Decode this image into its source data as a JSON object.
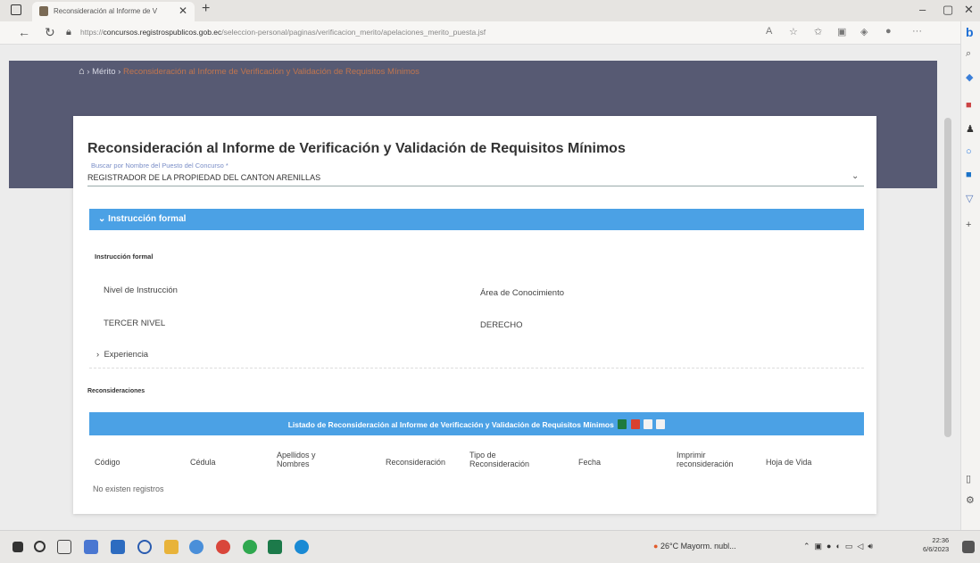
{
  "browser": {
    "tab_title": "Reconsideración al Informe de V",
    "url_prefix": "https://",
    "url_domain": "concursos.registrospublicos.gob.ec",
    "url_path": "/seleccion-personal/paginas/verificacion_merito/apelaciones_merito_puesta.jsf"
  },
  "breadcrumb": {
    "home_icon": "home-icon",
    "item1": "Mérito",
    "item2": "Reconsideración al Informe de Verificación y Validación de Requisitos Mínimos"
  },
  "card": {
    "title": "Reconsideración al Informe de Verificación y Validación de Requisitos Mínimos",
    "search_label": "Buscar por Nombre del Puesto del Concurso *",
    "search_value": "REGISTRADOR DE LA PROPIEDAD DEL CANTON ARENILLAS"
  },
  "accordion": {
    "instruccion_header": "Instrucción formal",
    "instruccion_section": "Instrucción formal",
    "col1_label": "Nivel de Instrucción",
    "col2_label": "Área de Conocimiento",
    "col1_value": "TERCER NIVEL",
    "col2_value": "DERECHO",
    "experiencia_header": "Experiencia"
  },
  "reconsideraciones": {
    "section_title": "Reconsideraciones",
    "table_title": "Listado de Reconsideración al Informe de Verificación y Validación de Requisitos Mínimos",
    "columns": [
      "Código",
      "Cédula",
      "Apellidos y Nombres",
      "Reconsideración",
      "Tipo de Reconsideración",
      "Fecha",
      "Imprimir reconsideración",
      "Hoja de Vida"
    ],
    "empty_message": "No existen registros"
  },
  "taskbar": {
    "weather": "26°C  Mayorm. nubl...",
    "time": "22:36",
    "date": "6/6/2023"
  },
  "colors": {
    "banner": "#575a73",
    "accent_blue": "#4ba1e5",
    "breadcrumb_current": "#c0754e"
  }
}
